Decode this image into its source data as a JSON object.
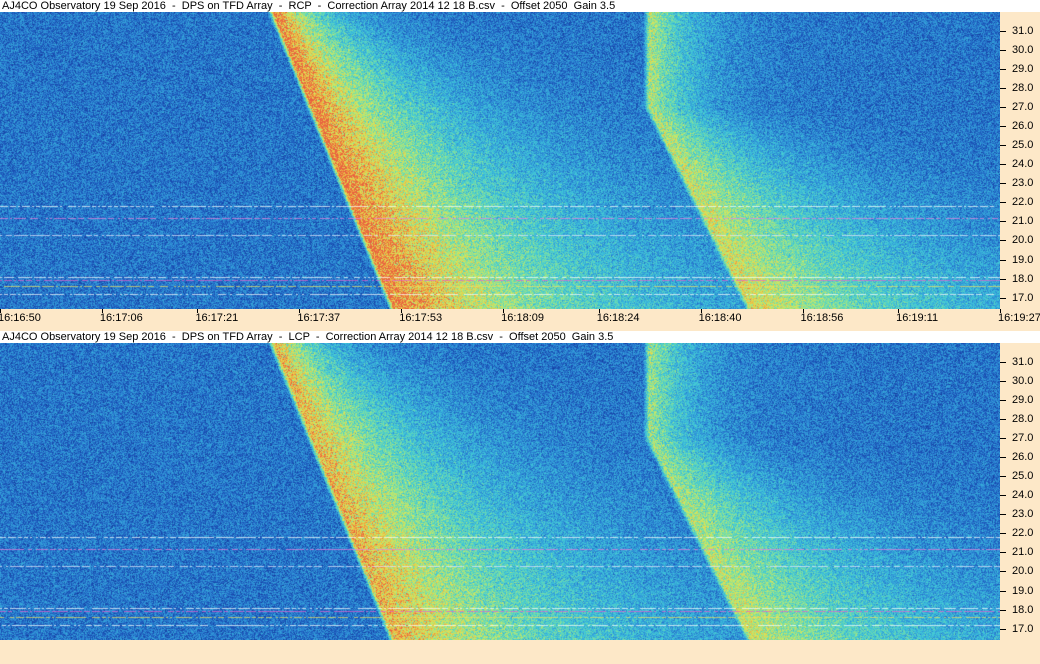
{
  "chart_data": [
    {
      "type": "heatmap",
      "title": "AJ4CO Observatory 19 Sep 2016  -  DPS on TFD Array  -  RCP  -  Correction Array 2014 12 18 B.csv  -  Offset 2050  Gain 3.5",
      "polarization": "RCP",
      "x_tick_labels": [
        "16:16:50",
        "16:17:06",
        "16:17:21",
        "16:17:37",
        "16:17:53",
        "16:18:09",
        "16:18:24",
        "16:18:40",
        "16:18:56",
        "16:19:11",
        "16:19:27"
      ],
      "y_tick_labels": [
        "17.0",
        "18.0",
        "19.0",
        "20.0",
        "21.0",
        "22.0",
        "23.0",
        "24.0",
        "25.0",
        "26.0",
        "27.0",
        "28.0",
        "29.0",
        "30.0",
        "31.0"
      ],
      "ylim": [
        16.4,
        32.0
      ],
      "xlim": [
        "16:16:50",
        "16:19:27"
      ],
      "colormap": [
        "#0b1f6e",
        "#1a4fb5",
        "#2f8fd8",
        "#3fc7d9",
        "#7ee0a0",
        "#d8e85a",
        "#f0b040",
        "#e86040"
      ],
      "features": [
        {
          "kind": "burst",
          "start_time": "16:17:33",
          "top_freq": 32.0,
          "bottom_freq": 16.4,
          "end_time_at_bottom": "16:17:52",
          "intensity": 0.95
        },
        {
          "kind": "burst",
          "start_time": "16:18:32",
          "top_freq": 27.0,
          "bottom_freq": 16.4,
          "end_time_at_bottom": "16:18:48",
          "intensity": 0.55
        }
      ],
      "interference_freqs": [
        17.2,
        17.6,
        17.9,
        18.1,
        20.3,
        21.2,
        21.8
      ]
    },
    {
      "type": "heatmap",
      "title": "AJ4CO Observatory 19 Sep 2016  -  DPS on TFD Array  -  LCP  -  Correction Array 2014 12 18 B.csv  -  Offset 2050  Gain 3.5",
      "polarization": "LCP",
      "x_tick_labels": [],
      "y_tick_labels": [
        "17.0",
        "18.0",
        "19.0",
        "20.0",
        "21.0",
        "22.0",
        "23.0",
        "24.0",
        "25.0",
        "26.0",
        "27.0",
        "28.0",
        "29.0",
        "30.0",
        "31.0"
      ],
      "ylim": [
        16.4,
        32.0
      ],
      "xlim": [
        "16:16:50",
        "16:19:27"
      ],
      "colormap": [
        "#0b1f6e",
        "#1a4fb5",
        "#2f8fd8",
        "#3fc7d9",
        "#7ee0a0",
        "#d8e85a",
        "#f0b040",
        "#e86040"
      ],
      "features": [
        {
          "kind": "burst",
          "start_time": "16:17:33",
          "top_freq": 32.0,
          "bottom_freq": 16.4,
          "end_time_at_bottom": "16:17:52",
          "intensity": 0.8
        },
        {
          "kind": "burst",
          "start_time": "16:18:32",
          "top_freq": 27.0,
          "bottom_freq": 16.4,
          "end_time_at_bottom": "16:18:48",
          "intensity": 0.5
        }
      ],
      "interference_freqs": [
        17.2,
        17.6,
        17.9,
        18.1,
        20.3,
        21.2,
        21.8
      ]
    }
  ]
}
